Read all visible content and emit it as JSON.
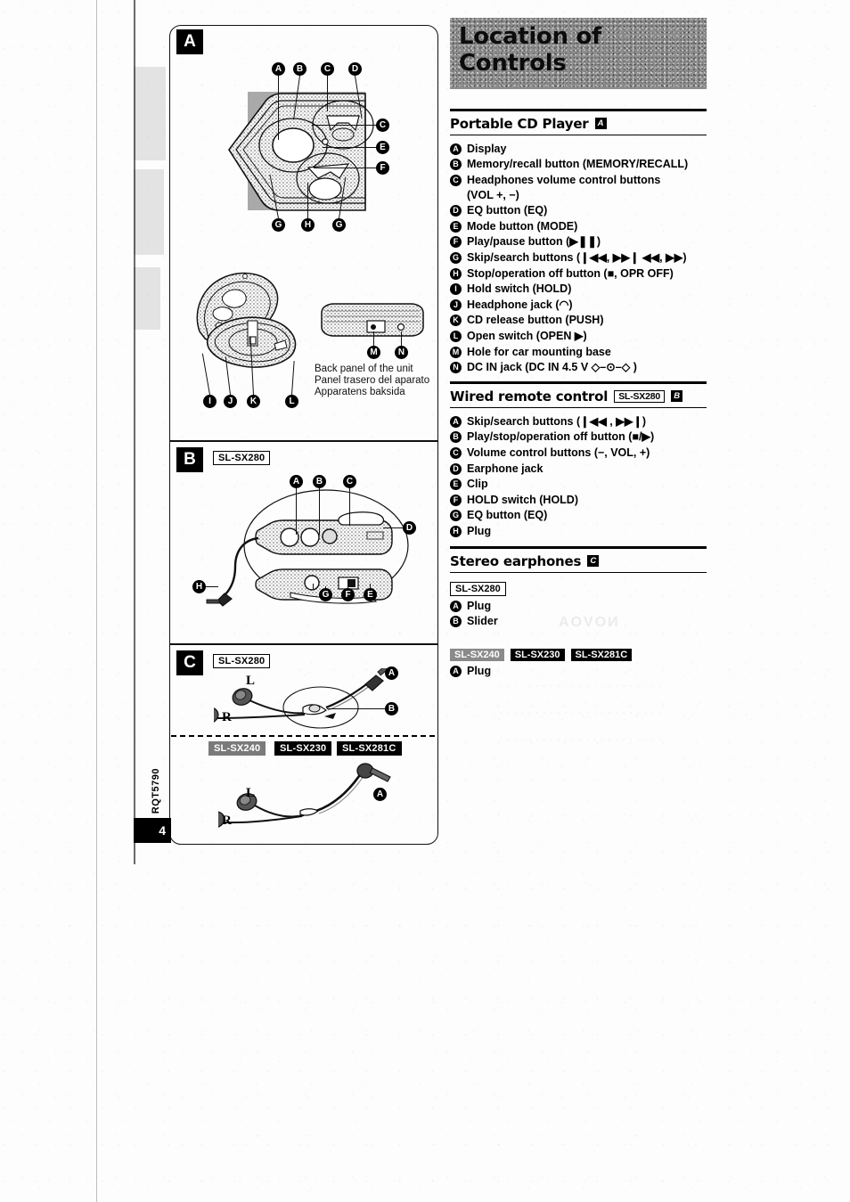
{
  "page": {
    "title_line1": "Location of",
    "title_line2": "Controls",
    "doc_code": "RQT5790",
    "page_number": "4"
  },
  "illustrations": {
    "panel_a": {
      "tab": "A",
      "callouts_top": [
        "A",
        "B",
        "C",
        "D"
      ],
      "callouts_right": [
        "C",
        "E",
        "F"
      ],
      "callouts_bottom": [
        "G",
        "H",
        "G"
      ],
      "callouts_open": [
        "I",
        "J",
        "K",
        "L"
      ],
      "callouts_back": [
        "M",
        "N"
      ],
      "caption_en": "Back panel of the unit",
      "caption_es": "Panel trasero del aparato",
      "caption_sv": "Apparatens baksida"
    },
    "panel_b": {
      "tab": "B",
      "model": "SL-SX280",
      "callouts_top": [
        "A",
        "B",
        "C"
      ],
      "callout_right": "D",
      "callouts_bottom": [
        "G",
        "F",
        "E"
      ],
      "callout_plug": "H"
    },
    "panel_c": {
      "tab": "C",
      "model_top": "SL-SX280",
      "label_left": "L",
      "label_right": "R",
      "callout_a": "A",
      "callout_b": "B",
      "models_bottom": [
        "SL-SX240",
        "SL-SX230",
        "SL-SX281C"
      ],
      "label_left2": "L",
      "label_right2": "R",
      "callout_a2": "A"
    }
  },
  "sections": [
    {
      "id": "portable-cd-player",
      "heading": "Portable CD Player",
      "badge": "A",
      "items": [
        {
          "key": "A",
          "text": "Display"
        },
        {
          "key": "B",
          "text": "Memory/recall button (MEMORY/RECALL)"
        },
        {
          "key": "C",
          "text": "Headphones volume control buttons\n(VOL +, −)"
        },
        {
          "key": "D",
          "text": "EQ button (EQ)"
        },
        {
          "key": "E",
          "text": "Mode button (MODE)"
        },
        {
          "key": "F",
          "text": "Play/pause button (▶❚❚)"
        },
        {
          "key": "G",
          "text": "Skip/search buttons (❙◀◀, ▶▶❙ ◀◀, ▶▶)"
        },
        {
          "key": "H",
          "text": "Stop/operation off button (■, OPR OFF)"
        },
        {
          "key": "I",
          "text": "Hold switch (HOLD)"
        },
        {
          "key": "J",
          "text": "Headphone jack (◠)"
        },
        {
          "key": "K",
          "text": "CD release button (PUSH)"
        },
        {
          "key": "L",
          "text": "Open switch (OPEN ▶)"
        },
        {
          "key": "M",
          "text": "Hole for car mounting base"
        },
        {
          "key": "N",
          "text": "DC IN jack (DC IN 4.5 V  ◇–⊙–◇ )"
        }
      ]
    },
    {
      "id": "wired-remote-control",
      "heading": "Wired remote control",
      "model": "SL-SX280",
      "badge": "B",
      "items": [
        {
          "key": "A",
          "text": "Skip/search buttons (❙◀◀ , ▶▶❙)"
        },
        {
          "key": "B",
          "text": "Play/stop/operation off button (■/▶)"
        },
        {
          "key": "C",
          "text": "Volume control buttons (−, VOL, +)"
        },
        {
          "key": "D",
          "text": "Earphone jack"
        },
        {
          "key": "E",
          "text": "Clip"
        },
        {
          "key": "F",
          "text": "HOLD switch (HOLD)"
        },
        {
          "key": "G",
          "text": "EQ button (EQ)"
        },
        {
          "key": "H",
          "text": "Plug"
        }
      ]
    },
    {
      "id": "stereo-earphones",
      "heading": "Stereo earphones",
      "badge": "C",
      "group1_model": "SL-SX280",
      "group1_items": [
        {
          "key": "A",
          "text": "Plug"
        },
        {
          "key": "B",
          "text": "Slider"
        }
      ],
      "group2_models": [
        "SL-SX240",
        "SL-SX230",
        "SL-SX281C"
      ],
      "group2_items": [
        {
          "key": "A",
          "text": "Plug"
        }
      ]
    }
  ],
  "colors": {
    "banner_gray": "#8d8d8d",
    "ink_black": "#000000",
    "paper": "#fdfdfd",
    "model_gray": "#8a8a8a"
  }
}
